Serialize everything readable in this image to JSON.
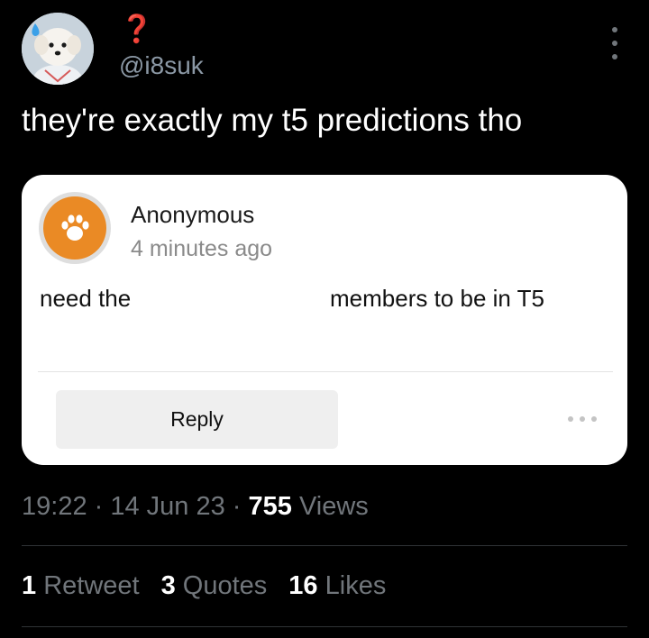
{
  "tweet": {
    "display_name": "❓",
    "handle": "@i8suk",
    "text": "they're exactly my t5 predictions tho",
    "more_icon": "more-vertical-icon"
  },
  "card": {
    "author": "Anonymous",
    "time": "4 minutes ago",
    "message_start": "need the",
    "message_end": "members to be in T5",
    "reply_label": "Reply",
    "avatar_icon": "paw-icon",
    "avatar_color": "#ea8a25",
    "more_icon": "more-horizontal-icon"
  },
  "meta": {
    "time": "19:22",
    "sep1": " · ",
    "date": "14 Jun 23",
    "sep2": " · ",
    "views_count": "755",
    "views_label": " Views"
  },
  "stats": {
    "retweets_count": "1",
    "retweets_label": " Retweet",
    "quotes_count": "3",
    "quotes_label": " Quotes",
    "likes_count": "16",
    "likes_label": " Likes"
  },
  "colors": {
    "background": "#000000",
    "name_red": "#e8233c",
    "muted": "#71767b",
    "card_bg": "#ffffff"
  }
}
